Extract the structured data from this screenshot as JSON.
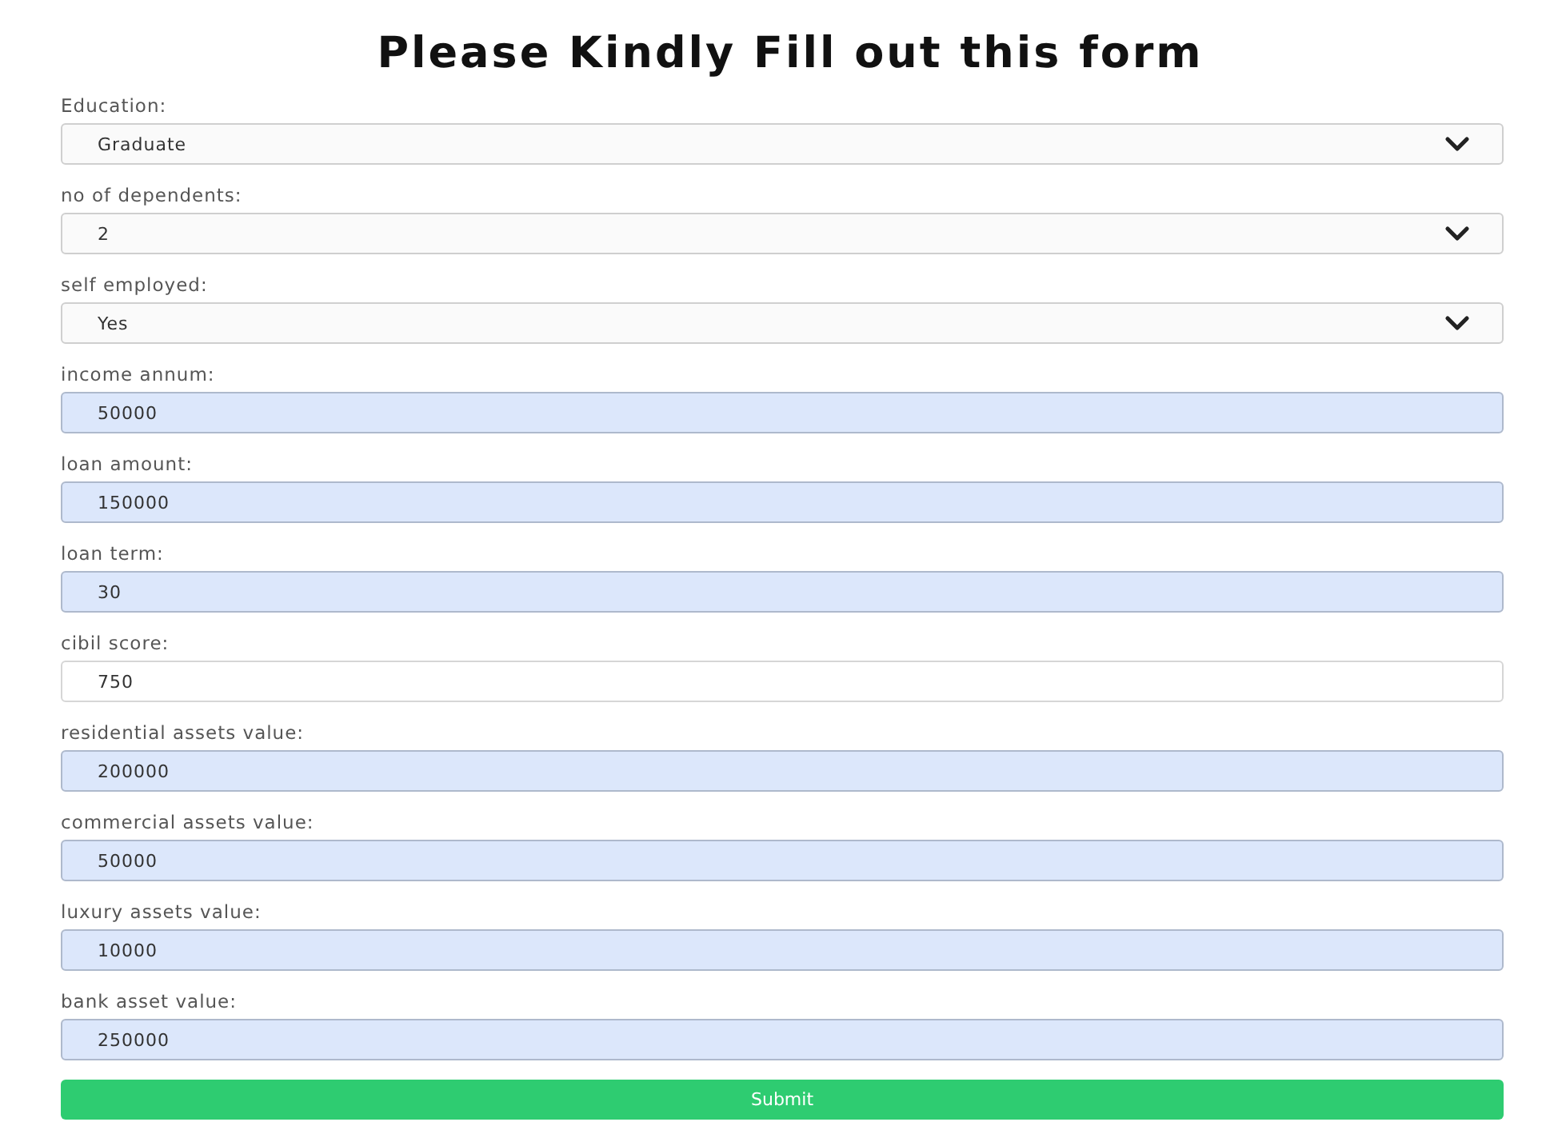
{
  "title": "Please Kindly Fill out this form",
  "fields": [
    {
      "kind": "select",
      "label": "Education:",
      "value": "Graduate",
      "autofilled": false
    },
    {
      "kind": "select",
      "label": "no of dependents:",
      "value": "2",
      "autofilled": false
    },
    {
      "kind": "select",
      "label": "self employed:",
      "value": "Yes",
      "autofilled": false
    },
    {
      "kind": "input",
      "label": "income annum:",
      "value": "50000",
      "autofilled": true
    },
    {
      "kind": "input",
      "label": "loan amount:",
      "value": "150000",
      "autofilled": true
    },
    {
      "kind": "input",
      "label": "loan term:",
      "value": "30",
      "autofilled": true
    },
    {
      "kind": "input",
      "label": "cibil score:",
      "value": "750",
      "autofilled": false
    },
    {
      "kind": "input",
      "label": "residential assets value:",
      "value": "200000",
      "autofilled": true
    },
    {
      "kind": "input",
      "label": "commercial assets value:",
      "value": "50000",
      "autofilled": true
    },
    {
      "kind": "input",
      "label": "luxury assets value:",
      "value": "10000",
      "autofilled": true
    },
    {
      "kind": "input",
      "label": "bank asset value:",
      "value": "250000",
      "autofilled": true
    }
  ],
  "submit": "Submit"
}
